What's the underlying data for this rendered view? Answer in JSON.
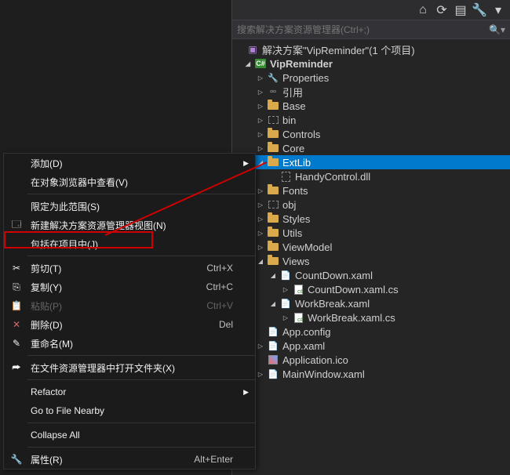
{
  "search": {
    "placeholder": "搜索解决方案资源管理器(Ctrl+;)"
  },
  "solution": {
    "root_label": "解决方案\"VipReminder\"(1 个项目)",
    "project": "VipReminder",
    "properties": "Properties",
    "references": "引用",
    "folders": {
      "base": "Base",
      "bin": "bin",
      "controls": "Controls",
      "core": "Core",
      "extlib": "ExtLib",
      "fonts": "Fonts",
      "obj": "obj",
      "styles": "Styles",
      "utils": "Utils",
      "viewmodel": "ViewModel",
      "views": "Views"
    },
    "files": {
      "handycontrol": "HandyControl.dll",
      "countdown_xaml": "CountDown.xaml",
      "countdown_cs": "CountDown.xaml.cs",
      "workbreak_xaml": "WorkBreak.xaml",
      "workbreak_cs": "WorkBreak.xaml.cs",
      "appconfig": "App.config",
      "appxaml": "App.xaml",
      "appicon": "Application.ico",
      "mainwindow": "MainWindow.xaml"
    }
  },
  "menu": {
    "add": "添加(D)",
    "view_in_browser": "在对象浏览器中查看(V)",
    "scope": "限定为此范围(S)",
    "new_view": "新建解决方案资源管理器视图(N)",
    "include": "包括在项目中(J)",
    "cut": "剪切(T)",
    "copy": "复制(Y)",
    "paste": "粘贴(P)",
    "delete": "删除(D)",
    "rename": "重命名(M)",
    "open_in_explorer": "在文件资源管理器中打开文件夹(X)",
    "refactor": "Refactor",
    "goto_file": "Go to File Nearby",
    "collapse": "Collapse All",
    "props": "属性(R)",
    "sc_cut": "Ctrl+X",
    "sc_copy": "Ctrl+C",
    "sc_paste": "Ctrl+V",
    "sc_del": "Del",
    "sc_props": "Alt+Enter"
  }
}
